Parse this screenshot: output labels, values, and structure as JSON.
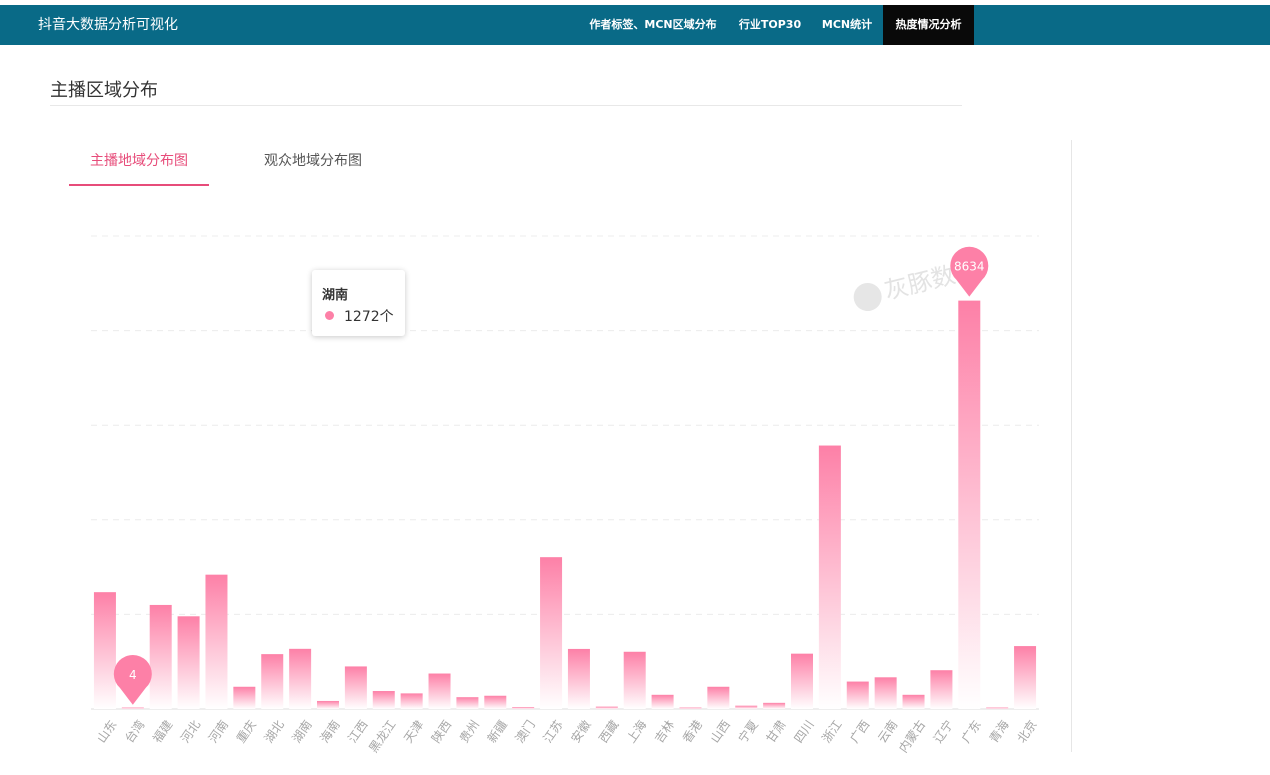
{
  "nav": {
    "brand": "抖音大数据分析可视化",
    "items": [
      {
        "label": "作者标签、MCN区域分布",
        "active": false
      },
      {
        "label": "行业TOP30",
        "active": false
      },
      {
        "label": "MCN统计",
        "active": false
      },
      {
        "label": "热度情况分析",
        "active": true
      }
    ],
    "color": "#096a87",
    "active_color": "#090909"
  },
  "section": {
    "title": "主播区域分布"
  },
  "tabs": [
    {
      "label": "主播地域分布图",
      "active": true
    },
    {
      "label": "观众地域分布图",
      "active": false
    }
  ],
  "tooltip": {
    "name": "湖南",
    "value": "1272个"
  },
  "watermark": "灰豚数",
  "chart_data": {
    "type": "bar",
    "categories": [
      "山东",
      "台湾",
      "福建",
      "河北",
      "河南",
      "重庆",
      "湖北",
      "湖南",
      "海南",
      "江西",
      "黑龙江",
      "天津",
      "陕西",
      "贵州",
      "新疆",
      "澳门",
      "江苏",
      "安徽",
      "西藏",
      "上海",
      "吉林",
      "香港",
      "山西",
      "宁夏",
      "甘肃",
      "四川",
      "浙江",
      "广西",
      "云南",
      "内蒙古",
      "辽宁",
      "广东",
      "青海",
      "北京"
    ],
    "series": [
      {
        "values": [
          2470,
          4,
          2200,
          1960,
          2840,
          470,
          1160,
          1272,
          170,
          900,
          380,
          330,
          750,
          250,
          280,
          40,
          3210,
          1270,
          50,
          1210,
          300,
          25,
          470,
          70,
          130,
          1170,
          5570,
          580,
          670,
          300,
          820,
          8634,
          20,
          1330
        ]
      }
    ],
    "ylim": [
      0,
      10000
    ],
    "grid": true,
    "bar_color_top": "#fd80a7",
    "bar_color_bottom": "#ffffff",
    "markpoints": [
      {
        "category": "广东",
        "value": 8634
      },
      {
        "category": "台湾",
        "value": 4
      }
    ]
  }
}
